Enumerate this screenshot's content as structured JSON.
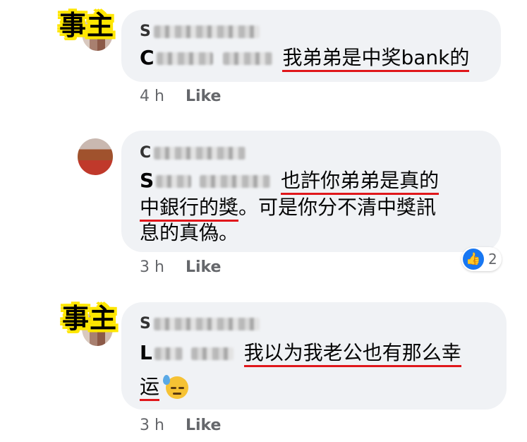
{
  "owner_tag": "事主",
  "comments": [
    {
      "author": "S",
      "mention": "C",
      "text_underlined": "我弟弟是中奖bank的",
      "time": "4 h",
      "like_label": "Like"
    },
    {
      "author": "C",
      "mention": "S",
      "line1_underlined": "也許你弟弟是真的",
      "line2_underlined": "中銀行的獎",
      "line2_rest": "。可是你分不清中獎訊",
      "line3": "息的真偽。",
      "time": "3 h",
      "like_label": "Like",
      "reaction_count": "2"
    },
    {
      "author": "S",
      "mention": "L",
      "line1_underlined": "我以为我老公也有那么幸",
      "line2_underlined": "运",
      "emoji": "downcast-face-with-sweat",
      "time": "3 h",
      "like_label": "Like"
    }
  ]
}
